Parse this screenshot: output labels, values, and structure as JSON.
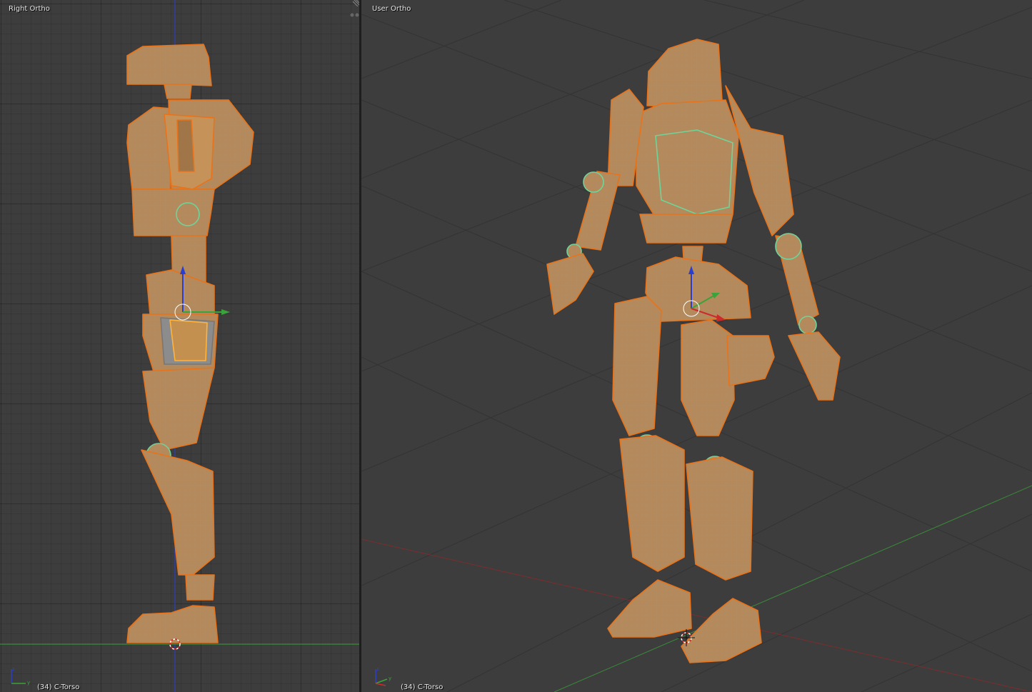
{
  "left_view": {
    "title": "Right Ortho",
    "status": "(34) C-Torso",
    "axes": {
      "z": "z",
      "y": "y"
    }
  },
  "right_view": {
    "title": "User Ortho",
    "status": "(34) C-Torso",
    "axes": {
      "z": "z",
      "y": "y"
    }
  },
  "colors": {
    "viewport_bg": "#3d3d3d",
    "mesh_fill": "#b38a5c",
    "edge_selected": "#e8731a",
    "edge_active": "#ffb33a",
    "seam_green": "#6fd49a",
    "axis_x": "#cc2b2b",
    "axis_y": "#3aa33a",
    "axis_z": "#2a3fd0"
  },
  "icons": [
    "3d-cursor-icon",
    "object-origin-icon",
    "manipulator-icon",
    "axis-gizmo-icon",
    "area-split-icon"
  ]
}
